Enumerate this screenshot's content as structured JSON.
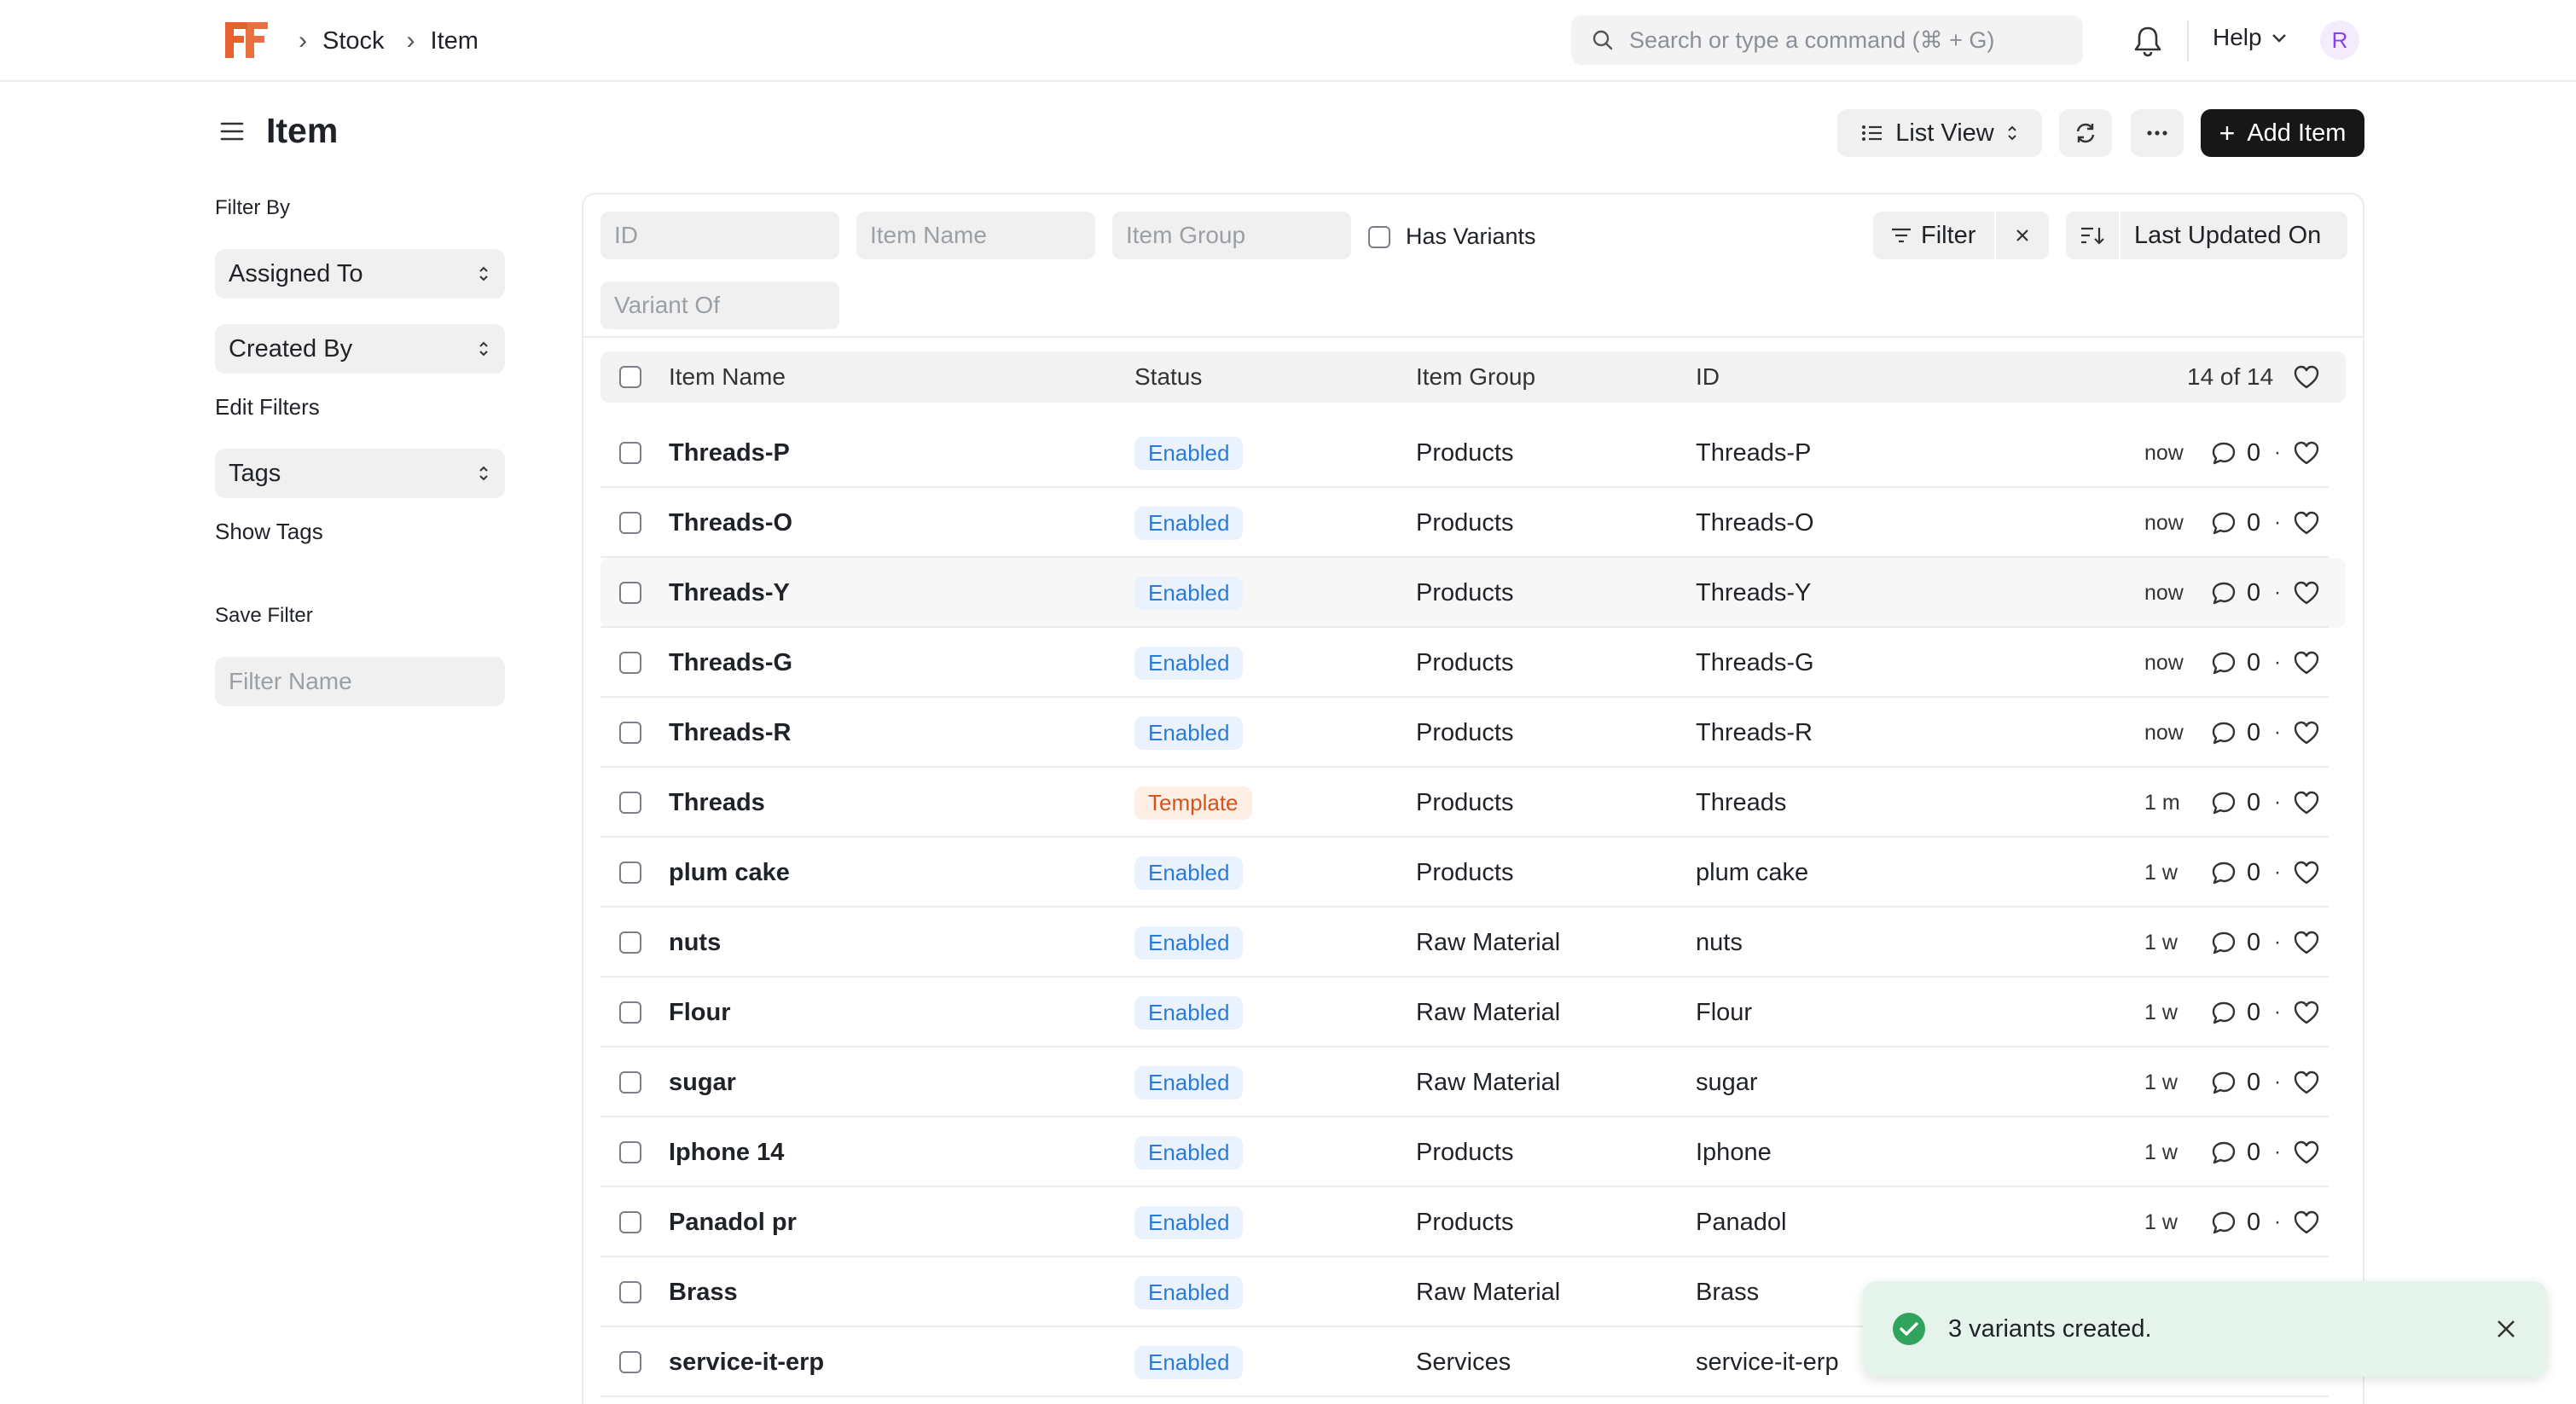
{
  "navbar": {
    "breadcrumbs": [
      "Stock",
      "Item"
    ],
    "search_placeholder": "Search or type a command (⌘ + G)",
    "help_label": "Help",
    "avatar_initial": "R"
  },
  "page": {
    "title": "Item",
    "list_view_label": "List View",
    "add_button_label": "Add Item"
  },
  "sidebar": {
    "filter_by_label": "Filter By",
    "assigned_to": "Assigned To",
    "created_by": "Created By",
    "edit_filters": "Edit Filters",
    "tags": "Tags",
    "show_tags": "Show Tags",
    "save_filter_label": "Save Filter",
    "filter_name_placeholder": "Filter Name"
  },
  "filters": {
    "id_placeholder": "ID",
    "item_name_placeholder": "Item Name",
    "item_group_placeholder": "Item Group",
    "variant_of_placeholder": "Variant Of",
    "has_variants_label": "Has Variants",
    "filter_label": "Filter",
    "sort_label": "Last Updated On"
  },
  "table": {
    "columns": {
      "name": "Item Name",
      "status": "Status",
      "group": "Item Group",
      "id": "ID"
    },
    "count": "14 of 14",
    "rows": [
      {
        "name": "Threads-P",
        "status": "Enabled",
        "status_type": "blue",
        "group": "Products",
        "id": "Threads-P",
        "time": "now",
        "comments": "0"
      },
      {
        "name": "Threads-O",
        "status": "Enabled",
        "status_type": "blue",
        "group": "Products",
        "id": "Threads-O",
        "time": "now",
        "comments": "0"
      },
      {
        "name": "Threads-Y",
        "status": "Enabled",
        "status_type": "blue",
        "group": "Products",
        "id": "Threads-Y",
        "time": "now",
        "comments": "0"
      },
      {
        "name": "Threads-G",
        "status": "Enabled",
        "status_type": "blue",
        "group": "Products",
        "id": "Threads-G",
        "time": "now",
        "comments": "0"
      },
      {
        "name": "Threads-R",
        "status": "Enabled",
        "status_type": "blue",
        "group": "Products",
        "id": "Threads-R",
        "time": "now",
        "comments": "0"
      },
      {
        "name": "Threads",
        "status": "Template",
        "status_type": "orange",
        "group": "Products",
        "id": "Threads",
        "time": "1 m",
        "comments": "0"
      },
      {
        "name": "plum cake",
        "status": "Enabled",
        "status_type": "blue",
        "group": "Products",
        "id": "plum cake",
        "time": "1 w",
        "comments": "0"
      },
      {
        "name": "nuts",
        "status": "Enabled",
        "status_type": "blue",
        "group": "Raw Material",
        "id": "nuts",
        "time": "1 w",
        "comments": "0"
      },
      {
        "name": "Flour",
        "status": "Enabled",
        "status_type": "blue",
        "group": "Raw Material",
        "id": "Flour",
        "time": "1 w",
        "comments": "0"
      },
      {
        "name": "sugar",
        "status": "Enabled",
        "status_type": "blue",
        "group": "Raw Material",
        "id": "sugar",
        "time": "1 w",
        "comments": "0"
      },
      {
        "name": "Iphone 14",
        "status": "Enabled",
        "status_type": "blue",
        "group": "Products",
        "id": "Iphone",
        "time": "1 w",
        "comments": "0"
      },
      {
        "name": "Panadol pr",
        "status": "Enabled",
        "status_type": "blue",
        "group": "Products",
        "id": "Panadol",
        "time": "1 w",
        "comments": "0"
      },
      {
        "name": "Brass",
        "status": "Enabled",
        "status_type": "blue",
        "group": "Raw Material",
        "id": "Brass",
        "time": "",
        "comments": ""
      },
      {
        "name": "service-it-erp",
        "status": "Enabled",
        "status_type": "blue",
        "group": "Services",
        "id": "service-it-erp",
        "time": "",
        "comments": ""
      }
    ]
  },
  "toast": {
    "message": "3 variants created."
  },
  "colors": {
    "brand": "#e8612c",
    "badge_blue": "#2a7bd6",
    "badge_orange": "#d5541c",
    "toast_bg": "#e5f4ea",
    "toast_icon": "#2fa45a"
  }
}
